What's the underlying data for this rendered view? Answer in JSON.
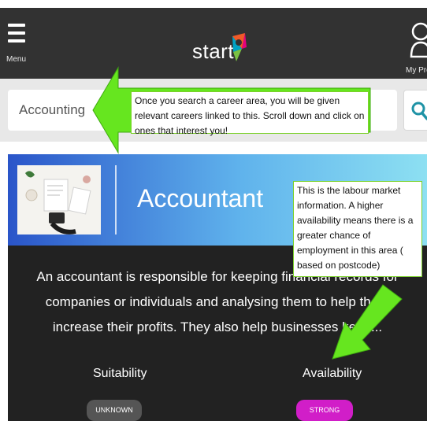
{
  "header": {
    "menu_label": "Menu",
    "logo_text": "start",
    "profile_label": "My Profile"
  },
  "search": {
    "value": "Accounting",
    "icon": "search-icon"
  },
  "career": {
    "title": "Accountant",
    "description": "An accountant is responsible for keeping financial records for companies or individuals and analysing them to help them increase their profits. They also help businesses keep...",
    "suitability_label": "Suitability",
    "suitability_value": "UNKNOWN",
    "availability_label": "Availability",
    "availability_value": "STRONG"
  },
  "annotations": {
    "search_note": "Once you search a career area, you will be given relevant careers linked to this. Scroll down and click on ones that interest you!",
    "labour_note": "This is the labour market information. A higher availability means there is a greater chance of employment in this area ( based on postcode)"
  },
  "colors": {
    "header_bg": "#323232",
    "accent_teal": "#1f93a6",
    "arrow_green": "#66e61f",
    "availability_strong": "#d11ec8",
    "suitability_unknown": "#555555"
  }
}
